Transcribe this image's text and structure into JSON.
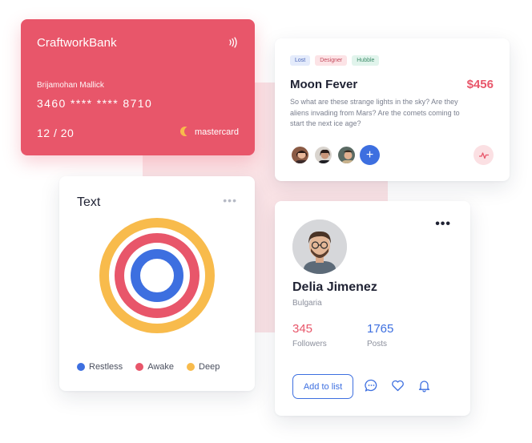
{
  "bank_card": {
    "bank_name": "CraftworkBank",
    "holder": "Brijamohan Mallick",
    "number": "3460  ****  ****  8710",
    "expiry": "12 / 20",
    "network": "mastercard",
    "color": "#e8566a"
  },
  "moon_card": {
    "tags": [
      {
        "label": "Lost",
        "bg": "#e4ebfb",
        "fg": "#4a66b8"
      },
      {
        "label": "Designer",
        "bg": "#fce3e6",
        "fg": "#c44a5c"
      },
      {
        "label": "Hubble",
        "bg": "#e1f4ec",
        "fg": "#3e8d6a"
      }
    ],
    "title": "Moon Fever",
    "price": "$456",
    "description": "So what are these strange lights in the sky? Are they aliens invading from Mars? Are the comets coming to start the next ice age?",
    "avatars": [
      "avatar-1",
      "avatar-2",
      "avatar-3"
    ],
    "add_member_icon": "plus-icon",
    "activity_icon": "pulse-icon"
  },
  "text_card": {
    "title": "Text",
    "menu_icon": "more-dots-icon",
    "legend": [
      {
        "label": "Restless",
        "color": "#3d6fe0"
      },
      {
        "label": "Awake",
        "color": "#e8566a"
      },
      {
        "label": "Deep",
        "color": "#f8bb4c"
      }
    ]
  },
  "profile_card": {
    "name": "Delia Jimenez",
    "country": "Bulgaria",
    "stats": [
      {
        "value": "345",
        "label": "Followers",
        "color": "#e8566a"
      },
      {
        "value": "1765",
        "label": "Posts",
        "color": "#3d6fe0"
      }
    ],
    "add_button_label": "Add to list",
    "action_icons": [
      "chat-icon",
      "heart-icon",
      "bell-icon"
    ]
  }
}
